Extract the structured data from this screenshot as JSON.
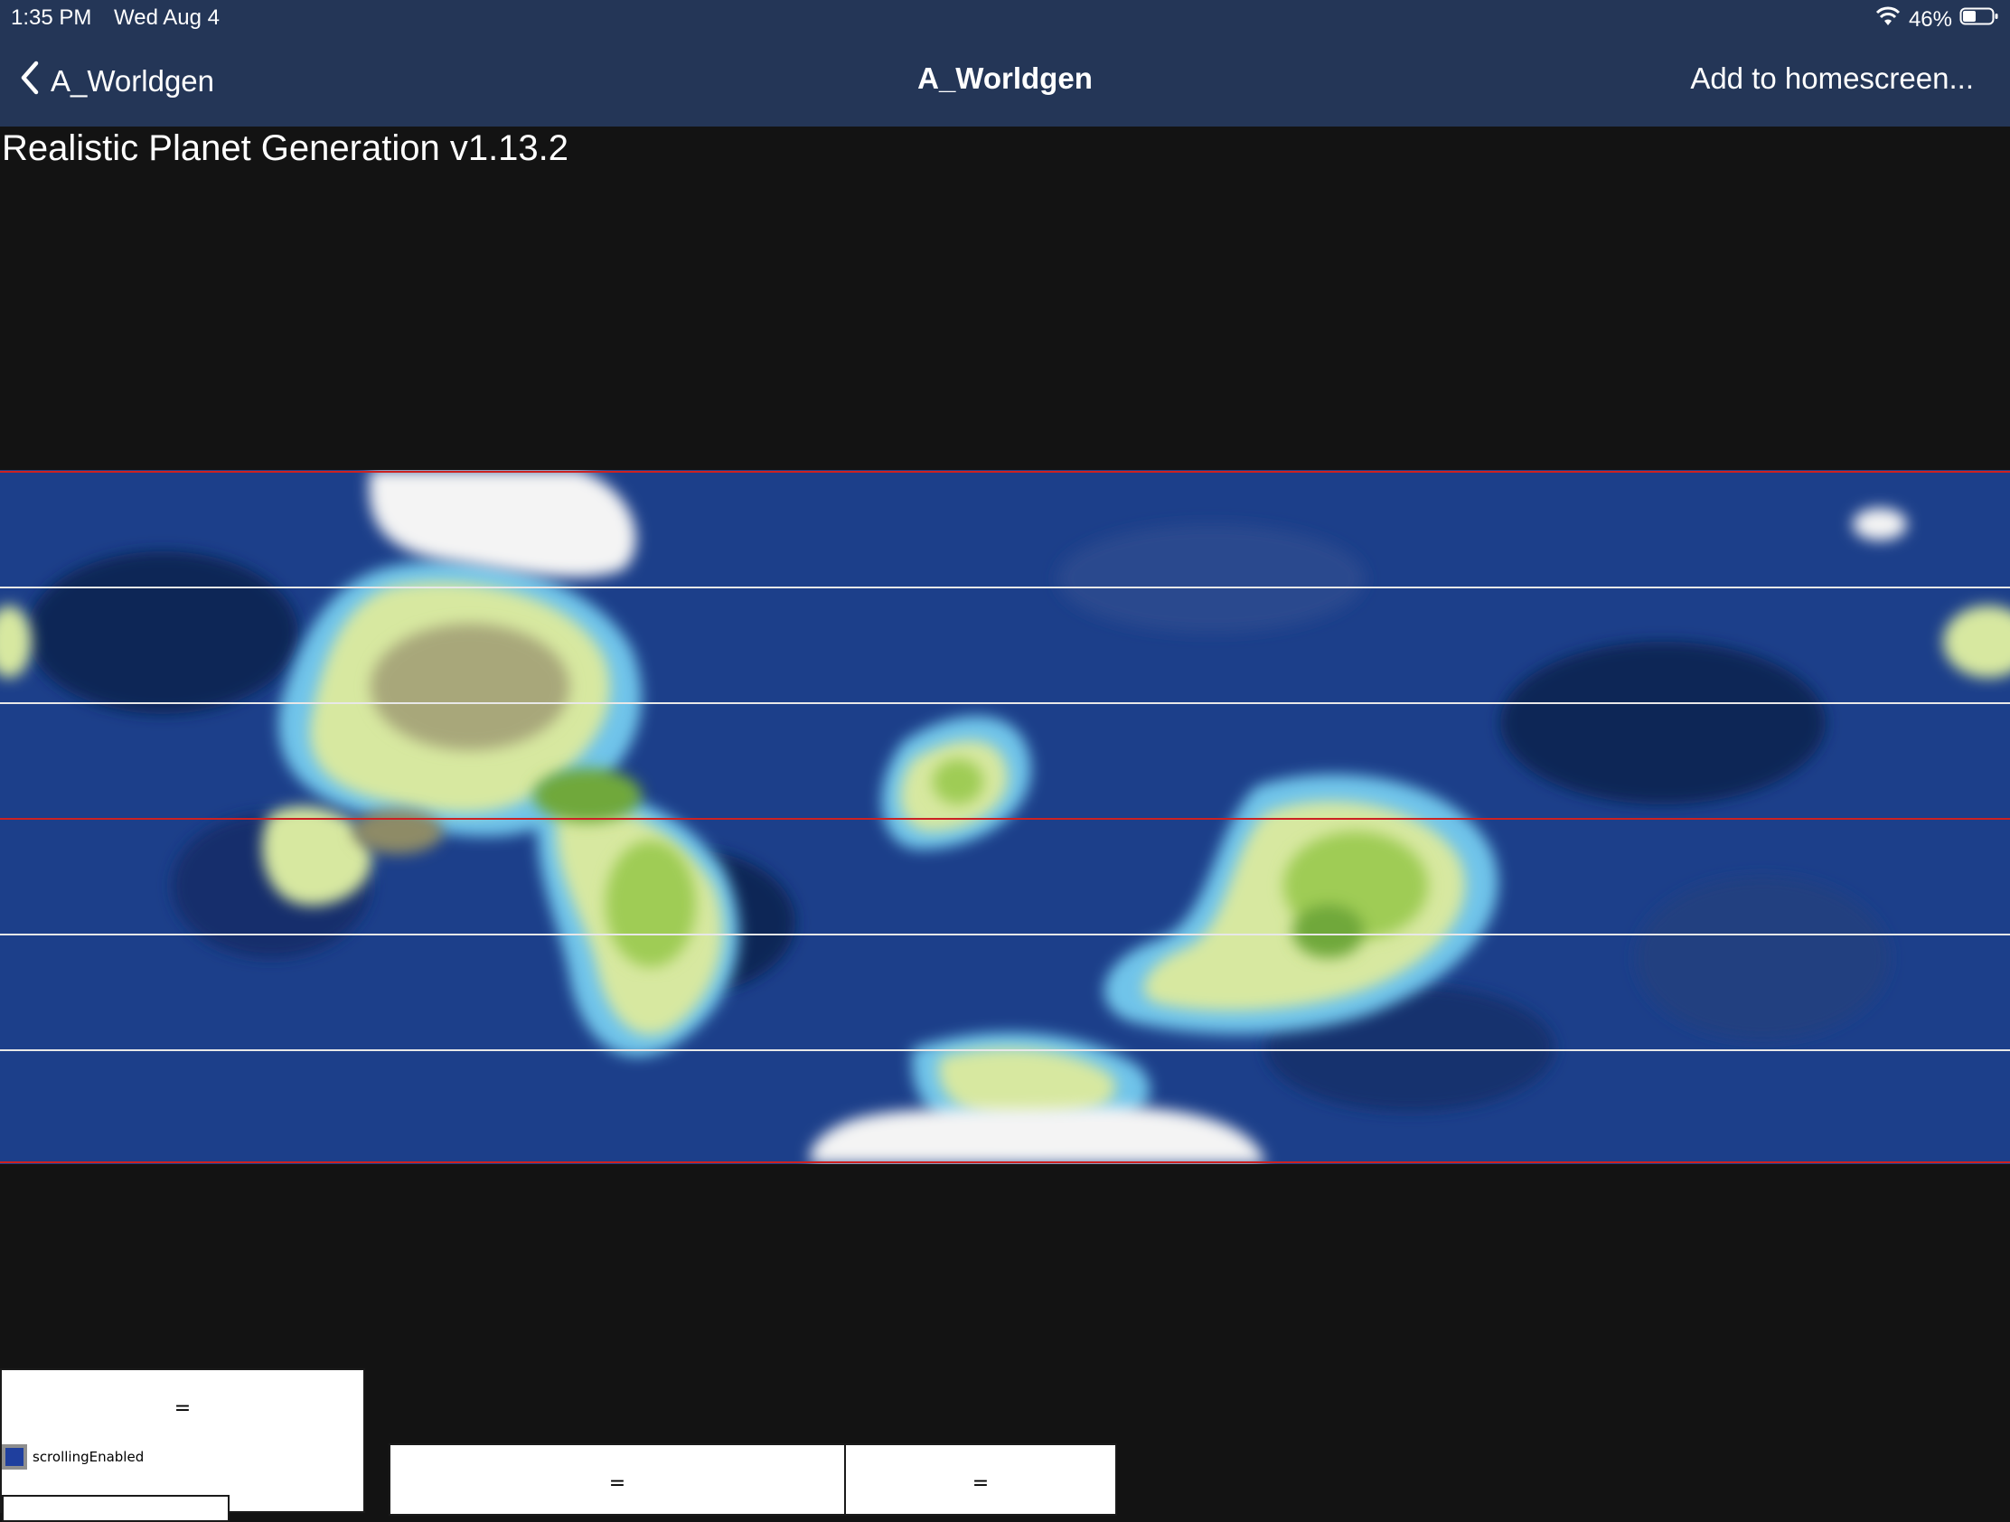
{
  "status_bar": {
    "time": "1:35 PM",
    "date": "Wed Aug 4",
    "battery_percent": "46%",
    "battery_level": 0.46,
    "wifi_icon": "wifi-icon",
    "battery_icon": "battery-icon"
  },
  "nav": {
    "back_label": "A_Worldgen",
    "title": "A_Worldgen",
    "add_to_homescreen": "Add to homescreen...",
    "back_icon": "chevron-left-icon"
  },
  "page": {
    "heading": "Realistic Planet Generation v1.13.2"
  },
  "map": {
    "description_icon": "planet-map-image",
    "colors": {
      "deep_ocean": "#0f2557",
      "ocean": "#1c3f8a",
      "shallow": "#3f8fd6",
      "coast": "#6fc4ea",
      "lowland": "#d7e8a0",
      "grassland": "#9fcc55",
      "forest": "#6fa83a",
      "hills": "#a8a77a",
      "ice": "#f4f4f4",
      "equator_line": "#cc2222",
      "latitude_line": "#e8e8e8"
    }
  },
  "controls": {
    "left_panel_symbol": "=",
    "scrolling_checkbox_label": "scrollingEnabled",
    "checkbox_color": "#1f3f9e",
    "mid_panel_symbol": "=",
    "right_panel_symbol": "="
  }
}
